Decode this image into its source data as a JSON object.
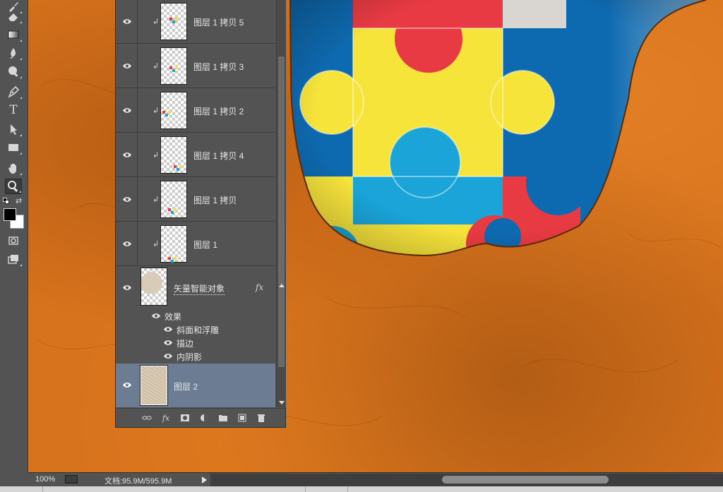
{
  "tools": [
    {
      "name": "brush-tool-icon"
    },
    {
      "name": "eraser-tool-icon"
    },
    {
      "name": "gradient-tool-icon"
    },
    {
      "name": "blur-tool-icon"
    },
    {
      "name": "dodge-tool-icon"
    },
    {
      "name": "pen-tool-icon"
    },
    {
      "name": "type-tool-icon",
      "glyph": "T"
    },
    {
      "name": "path-selection-tool-icon"
    },
    {
      "name": "rectangle-tool-icon"
    },
    {
      "name": "hand-tool-icon"
    },
    {
      "name": "zoom-tool-icon"
    }
  ],
  "colors": {
    "foreground": "#000000",
    "background": "#ffffff",
    "canvas_orange": "#d8731d",
    "selected_layer": "#6b7c93",
    "puzzle_red": "#e83a43",
    "puzzle_yellow": "#f7e43b",
    "puzzle_blue": "#1aa4d8",
    "puzzle_darkblue": "#0e6ab0"
  },
  "layers": {
    "clipped": [
      {
        "name": "图层 1 拷贝 5"
      },
      {
        "name": "图层 1 拷贝 3"
      },
      {
        "name": "图层 1 拷贝 2"
      },
      {
        "name": "图层 1 拷贝 4"
      },
      {
        "name": "图层 1 拷贝"
      },
      {
        "name": "图层 1"
      }
    ],
    "smart_object": {
      "name": "矢量智能对象",
      "fx": "fx",
      "effects_label": "效果",
      "effects": [
        "斜面和浮雕",
        "描边",
        "内阴影"
      ]
    },
    "selected": {
      "name": "图层 2"
    }
  },
  "footer_icons": [
    "link-icon",
    "fx-icon",
    "mask-icon",
    "adjustment-icon",
    "folder-icon",
    "new-layer-icon",
    "trash-icon"
  ],
  "footer_fx_label": "fx",
  "status": {
    "zoom": "100%",
    "doc_info": "文档:95.9M/595.9M"
  }
}
